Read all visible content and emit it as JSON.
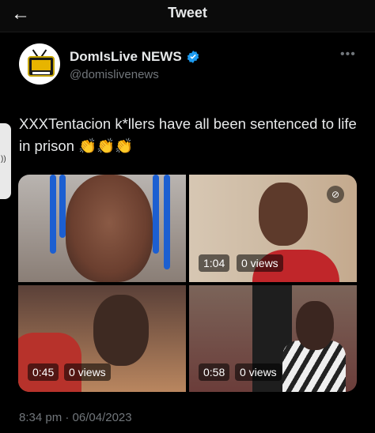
{
  "header": {
    "title": "Tweet",
    "back_icon": "arrow-left-icon"
  },
  "author": {
    "name": "DomIsLive NEWS",
    "handle": "@domislivenews",
    "verified": true
  },
  "tweet": {
    "text": "XXXTentacion k*llers have all been sentenced to life in prison 👏👏👏",
    "timestamp": "8:34 pm · 06/04/2023"
  },
  "media": [
    {
      "type": "image"
    },
    {
      "type": "video",
      "duration": "1:04",
      "views": "0 views"
    },
    {
      "type": "video",
      "duration": "0:45",
      "views": "0 views"
    },
    {
      "type": "video",
      "duration": "0:58",
      "views": "0 views"
    }
  ],
  "colors": {
    "background": "#000000",
    "text": "#e7e9ea",
    "muted": "#71767b",
    "verified": "#1d9bf0"
  }
}
